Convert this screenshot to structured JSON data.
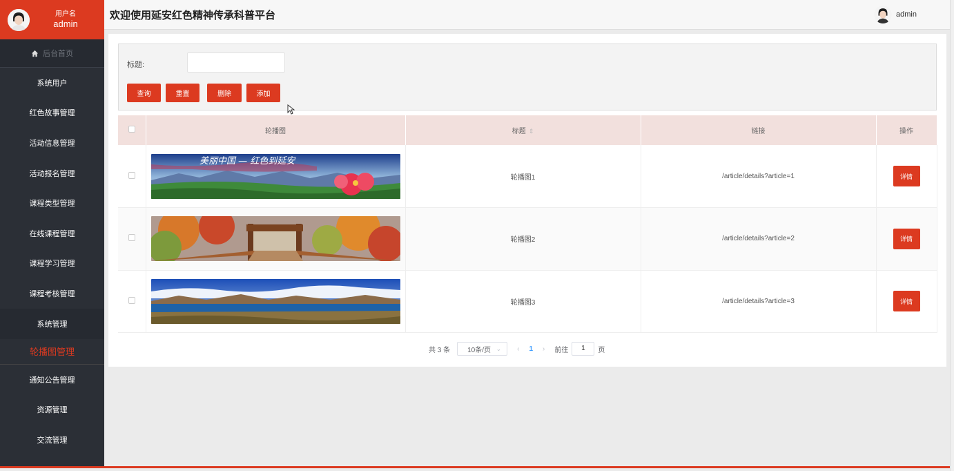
{
  "sidebar": {
    "user_label": "用户名",
    "user_name": "admin",
    "home": "后台首页",
    "items": [
      "系统用户",
      "红色故事管理",
      "活动信息管理",
      "活动报名管理",
      "课程类型管理",
      "在线课程管理",
      "课程学习管理",
      "课程考核管理"
    ],
    "system_group": "系统管理",
    "active_item": "轮播图管理",
    "items_after": [
      "通知公告管理",
      "资源管理",
      "交流管理"
    ]
  },
  "header": {
    "title": "欢迎使用延安红色精神传承科普平台",
    "user": "admin"
  },
  "filter": {
    "title_label": "标题:",
    "title_value": "",
    "buttons": {
      "query": "查询",
      "reset": "重置",
      "delete": "删除",
      "add": "添加"
    }
  },
  "table": {
    "headers": {
      "image": "轮播图",
      "title": "标题",
      "link": "链接",
      "action": "操作"
    },
    "rows": [
      {
        "title": "轮播图1",
        "link": "/article/details?article=1",
        "action": "详情",
        "image_text": "美丽中国 — 红色到延安"
      },
      {
        "title": "轮播图2",
        "link": "/article/details?article=2",
        "action": "详情",
        "image_text": ""
      },
      {
        "title": "轮播图3",
        "link": "/article/details?article=3",
        "action": "详情",
        "image_text": ""
      }
    ]
  },
  "pagination": {
    "total": "共 3 条",
    "page_size": "10条/页",
    "current_page": "1",
    "goto_label": "前往",
    "goto_value": "1",
    "page_unit": "页"
  },
  "colors": {
    "accent": "#dc3a20",
    "sidebar": "#2b2f36",
    "header_row": "#f2e0dd"
  }
}
